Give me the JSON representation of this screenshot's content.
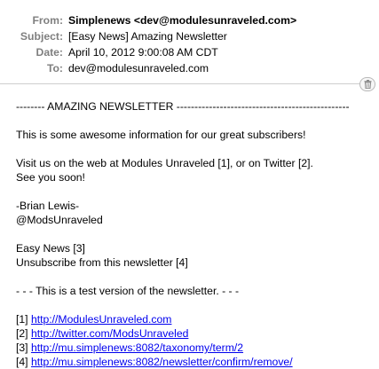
{
  "header": {
    "from_label": "From:",
    "from_value": "Simplenews <dev@modulesunraveled.com>",
    "subject_label": "Subject:",
    "subject_value": "[Easy News] Amazing Newsletter",
    "date_label": "Date:",
    "date_value": "April 10, 2012 9:00:08 AM CDT",
    "to_label": "To:",
    "to_value": "dev@modulesunraveled.com"
  },
  "toolbar": {
    "trash_icon": "trash-icon"
  },
  "message": {
    "banner": "-------- AMAZING NEWSLETTER ------------------------------------------------",
    "intro": "This is some awesome information for our great subscribers!",
    "visit_line1": "Visit us on the web at Modules Unraveled [1], or on Twitter [2].",
    "visit_line2": "See you soon!",
    "signature_name": "-Brian Lewis-",
    "signature_handle": "@ModsUnraveled",
    "easy_news": "Easy News [3]",
    "unsubscribe": "Unsubscribe from this newsletter [4]",
    "test_notice": "- - - This is a test version of the newsletter. - - -",
    "links": [
      {
        "ref": "[1] ",
        "url": "http://ModulesUnraveled.com"
      },
      {
        "ref": "[2] ",
        "url": "http://twitter.com/ModsUnraveled"
      },
      {
        "ref": "[3] ",
        "url": "http://mu.simplenews:8082/taxonomy/term/2"
      },
      {
        "ref": "[4] ",
        "url": "http://mu.simplenews:8082/newsletter/confirm/remove/"
      }
    ]
  },
  "colors": {
    "label_gray": "#7f7f7f",
    "link_blue": "#0000ee",
    "divider": "#cfcfcf"
  }
}
